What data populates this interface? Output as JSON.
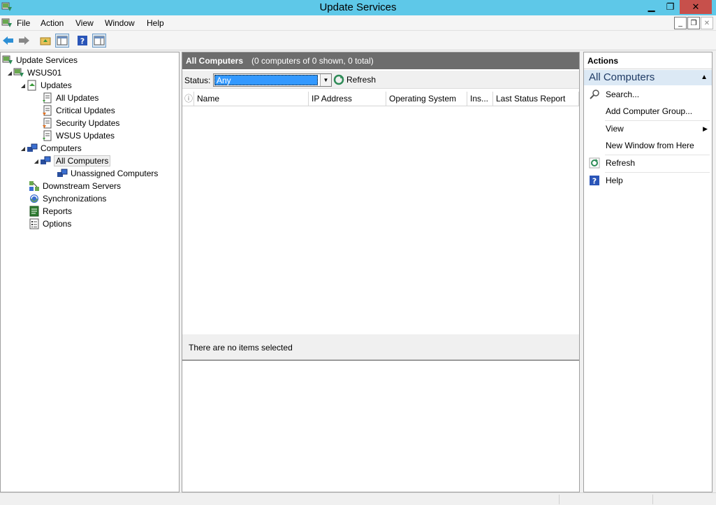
{
  "window": {
    "title": "Update Services"
  },
  "menu": {
    "items": [
      "File",
      "Action",
      "View",
      "Window",
      "Help"
    ]
  },
  "tree": {
    "root": "Update Services",
    "server": "WSUS01",
    "updates": "Updates",
    "all_updates": "All Updates",
    "critical_updates": "Critical Updates",
    "security_updates": "Security Updates",
    "wsus_updates": "WSUS Updates",
    "computers": "Computers",
    "all_computers": "All Computers",
    "unassigned_computers": "Unassigned Computers",
    "downstream_servers": "Downstream Servers",
    "synchronizations": "Synchronizations",
    "reports": "Reports",
    "options": "Options"
  },
  "center": {
    "title": "All Computers",
    "summary": "(0 computers of 0 shown, 0 total)",
    "status_label": "Status:",
    "status_value": "Any",
    "refresh_label": "Refresh",
    "columns": [
      "Name",
      "IP Address",
      "Operating System",
      "Ins...",
      "Last Status Report"
    ],
    "details_text": "There are no items selected"
  },
  "actions": {
    "title": "Actions",
    "section": "All Computers",
    "items": {
      "search": "Search...",
      "add_group": "Add Computer Group...",
      "view": "View",
      "new_window": "New Window from Here",
      "refresh": "Refresh",
      "help": "Help"
    }
  },
  "colors": {
    "titlebar": "#5ec8e8",
    "close_button": "#c7504b",
    "header_gray": "#6d6d6d",
    "selection_blue": "#3399ff",
    "actions_section_bg": "#dce9f5"
  }
}
